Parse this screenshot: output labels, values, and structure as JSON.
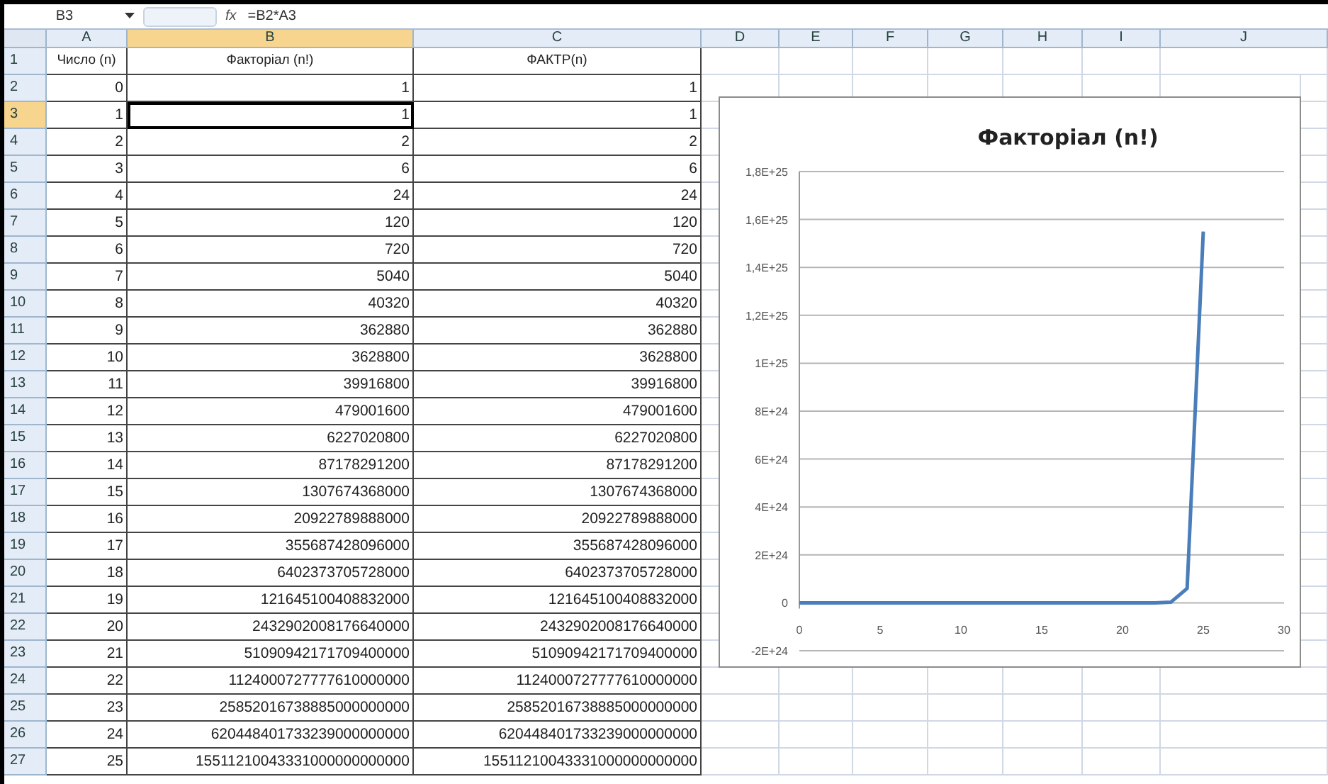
{
  "formula_bar": {
    "name_box": "B3",
    "fx_label": "fx",
    "formula": "=B2*A3"
  },
  "columns": [
    {
      "letter": "A",
      "selected": false
    },
    {
      "letter": "B",
      "selected": true
    },
    {
      "letter": "C",
      "selected": false
    },
    {
      "letter": "D",
      "selected": false
    },
    {
      "letter": "E",
      "selected": false
    },
    {
      "letter": "F",
      "selected": false
    },
    {
      "letter": "G",
      "selected": false
    },
    {
      "letter": "H",
      "selected": false
    },
    {
      "letter": "I",
      "selected": false
    },
    {
      "letter": "J",
      "selected": false
    }
  ],
  "rows": [
    {
      "number": "1",
      "selected": false,
      "kind": "header",
      "cells": [
        "Число (n)",
        "Факторіал (n!)",
        "ФАКТР(n)"
      ]
    },
    {
      "number": "2",
      "selected": false,
      "kind": "data",
      "cells": [
        "0",
        "1",
        "1"
      ]
    },
    {
      "number": "3",
      "selected": true,
      "kind": "data",
      "cells": [
        "1",
        "1",
        "1"
      ]
    },
    {
      "number": "4",
      "selected": false,
      "kind": "data",
      "cells": [
        "2",
        "2",
        "2"
      ]
    },
    {
      "number": "5",
      "selected": false,
      "kind": "data",
      "cells": [
        "3",
        "6",
        "6"
      ]
    },
    {
      "number": "6",
      "selected": false,
      "kind": "data",
      "cells": [
        "4",
        "24",
        "24"
      ]
    },
    {
      "number": "7",
      "selected": false,
      "kind": "data",
      "cells": [
        "5",
        "120",
        "120"
      ]
    },
    {
      "number": "8",
      "selected": false,
      "kind": "data",
      "cells": [
        "6",
        "720",
        "720"
      ]
    },
    {
      "number": "9",
      "selected": false,
      "kind": "data",
      "cells": [
        "7",
        "5040",
        "5040"
      ]
    },
    {
      "number": "10",
      "selected": false,
      "kind": "data",
      "cells": [
        "8",
        "40320",
        "40320"
      ]
    },
    {
      "number": "11",
      "selected": false,
      "kind": "data",
      "cells": [
        "9",
        "362880",
        "362880"
      ]
    },
    {
      "number": "12",
      "selected": false,
      "kind": "data",
      "cells": [
        "10",
        "3628800",
        "3628800"
      ]
    },
    {
      "number": "13",
      "selected": false,
      "kind": "data",
      "cells": [
        "11",
        "39916800",
        "39916800"
      ]
    },
    {
      "number": "14",
      "selected": false,
      "kind": "data",
      "cells": [
        "12",
        "479001600",
        "479001600"
      ]
    },
    {
      "number": "15",
      "selected": false,
      "kind": "data",
      "cells": [
        "13",
        "6227020800",
        "6227020800"
      ]
    },
    {
      "number": "16",
      "selected": false,
      "kind": "data",
      "cells": [
        "14",
        "87178291200",
        "87178291200"
      ]
    },
    {
      "number": "17",
      "selected": false,
      "kind": "data",
      "cells": [
        "15",
        "1307674368000",
        "1307674368000"
      ]
    },
    {
      "number": "18",
      "selected": false,
      "kind": "data",
      "cells": [
        "16",
        "20922789888000",
        "20922789888000"
      ]
    },
    {
      "number": "19",
      "selected": false,
      "kind": "data",
      "cells": [
        "17",
        "355687428096000",
        "355687428096000"
      ]
    },
    {
      "number": "20",
      "selected": false,
      "kind": "data",
      "cells": [
        "18",
        "6402373705728000",
        "6402373705728000"
      ]
    },
    {
      "number": "21",
      "selected": false,
      "kind": "data",
      "cells": [
        "19",
        "121645100408832000",
        "121645100408832000"
      ]
    },
    {
      "number": "22",
      "selected": false,
      "kind": "data",
      "cells": [
        "20",
        "2432902008176640000",
        "2432902008176640000"
      ]
    },
    {
      "number": "23",
      "selected": false,
      "kind": "data",
      "cells": [
        "21",
        "51090942171709400000",
        "51090942171709400000"
      ]
    },
    {
      "number": "24",
      "selected": false,
      "kind": "data",
      "cells": [
        "22",
        "1124000727777610000000",
        "1124000727777610000000"
      ]
    },
    {
      "number": "25",
      "selected": false,
      "kind": "data",
      "cells": [
        "23",
        "25852016738885000000000",
        "25852016738885000000000"
      ]
    },
    {
      "number": "26",
      "selected": false,
      "kind": "data",
      "cells": [
        "24",
        "620448401733239000000000",
        "620448401733239000000000"
      ]
    },
    {
      "number": "27",
      "selected": false,
      "kind": "data",
      "cells": [
        "25",
        "15511210043331000000000000",
        "15511210043331000000000000"
      ]
    }
  ],
  "chart": {
    "chart_data": {
      "type": "line",
      "title": "Факторіал (n!)",
      "x": [
        0,
        1,
        2,
        3,
        4,
        5,
        6,
        7,
        8,
        9,
        10,
        11,
        12,
        13,
        14,
        15,
        16,
        17,
        18,
        19,
        20,
        21,
        22,
        23,
        24,
        25
      ],
      "series": [
        {
          "color": "#4a7ebb",
          "values": [
            0,
            0,
            0,
            0,
            0,
            0,
            0,
            0,
            0,
            0,
            0,
            0,
            0,
            0,
            0,
            0,
            0,
            0,
            0,
            0,
            0,
            0,
            0,
            3e+22,
            6e+23,
            1.55e+25
          ]
        }
      ],
      "grid": true,
      "xlim": [
        0,
        30
      ],
      "ylim": [
        -2e+24,
        1.8e+25
      ],
      "xticks": [
        0,
        5,
        10,
        15,
        20,
        25,
        30
      ],
      "yticks": [
        {
          "value": 1.8e+25,
          "label": "1,8E+25"
        },
        {
          "value": 1.6e+25,
          "label": "1,6E+25"
        },
        {
          "value": 1.4e+25,
          "label": "1,4E+25"
        },
        {
          "value": 1.2e+25,
          "label": "1,2E+25"
        },
        {
          "value": 1e+25,
          "label": "1E+25"
        },
        {
          "value": 8e+24,
          "label": "8E+24"
        },
        {
          "value": 6e+24,
          "label": "6E+24"
        },
        {
          "value": 4e+24,
          "label": "4E+24"
        },
        {
          "value": 2e+24,
          "label": "2E+24"
        },
        {
          "value": 0,
          "label": "0"
        },
        {
          "value": -2e+24,
          "label": "-2E+24"
        }
      ]
    }
  }
}
